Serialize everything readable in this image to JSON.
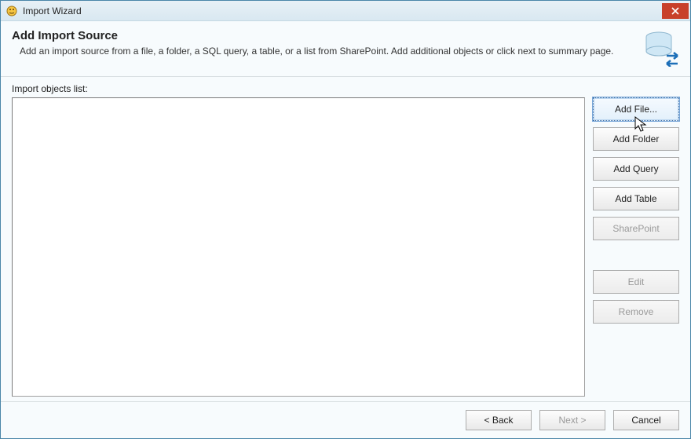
{
  "window": {
    "title": "Import Wizard"
  },
  "header": {
    "title": "Add Import Source",
    "description": "Add an import source from a file, a folder, a SQL query, a table, or a list from SharePoint. Add additional objects or click next to summary page."
  },
  "list": {
    "label": "Import objects list:"
  },
  "buttons": {
    "add_file": "Add File...",
    "add_folder": "Add Folder",
    "add_query": "Add Query",
    "add_table": "Add Table",
    "sharepoint": "SharePoint",
    "edit": "Edit",
    "remove": "Remove"
  },
  "footer": {
    "back": "< Back",
    "next": "Next >",
    "cancel": "Cancel"
  }
}
